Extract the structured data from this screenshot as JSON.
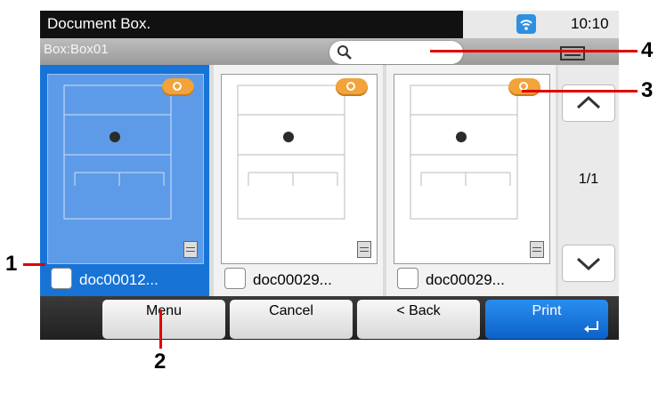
{
  "statusbar": {
    "title": "Document Box.",
    "time": "10:10",
    "wifi_icon": "wifi-icon"
  },
  "toolbar": {
    "box_label": "Box:Box01",
    "search_icon": "search-icon",
    "view_icon": "view-toggle-icon"
  },
  "documents": [
    {
      "name": "doc00012...",
      "selected": true
    },
    {
      "name": "doc00029...",
      "selected": false
    },
    {
      "name": "doc00029...",
      "selected": false
    }
  ],
  "pager": {
    "label": "1/1"
  },
  "bottom": {
    "menu": "Menu",
    "cancel": "Cancel",
    "back": "< Back",
    "print": "Print"
  },
  "callouts": [
    "1",
    "2",
    "3",
    "4"
  ],
  "colors": {
    "accent": "#1773d6",
    "callout_line": "#e00000",
    "badge": "#f2a33a"
  }
}
